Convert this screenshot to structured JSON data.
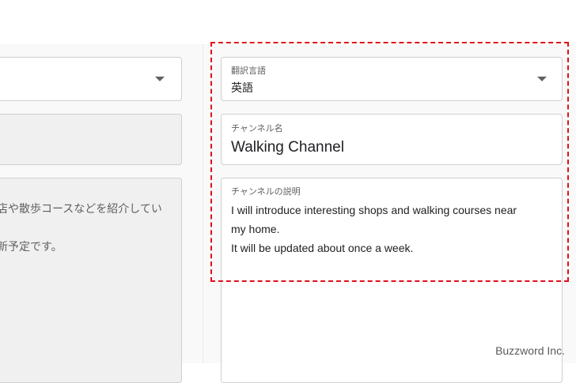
{
  "left": {
    "desc_line1_fragment": "店や散歩コースなどを紹介してい",
    "desc_line2_fragment": "新予定です。"
  },
  "right": {
    "language": {
      "label": "翻訳言語",
      "value": "英語"
    },
    "channel_name": {
      "label": "チャンネル名",
      "value": "Walking Channel"
    },
    "channel_desc": {
      "label": "チャンネルの説明",
      "line1": "I will introduce interesting shops and walking courses near",
      "line2": "my home.",
      "line3": "It will be updated about once a week."
    }
  },
  "watermark": "Buzzword Inc.",
  "colors": {
    "highlight": "#e0101a"
  }
}
